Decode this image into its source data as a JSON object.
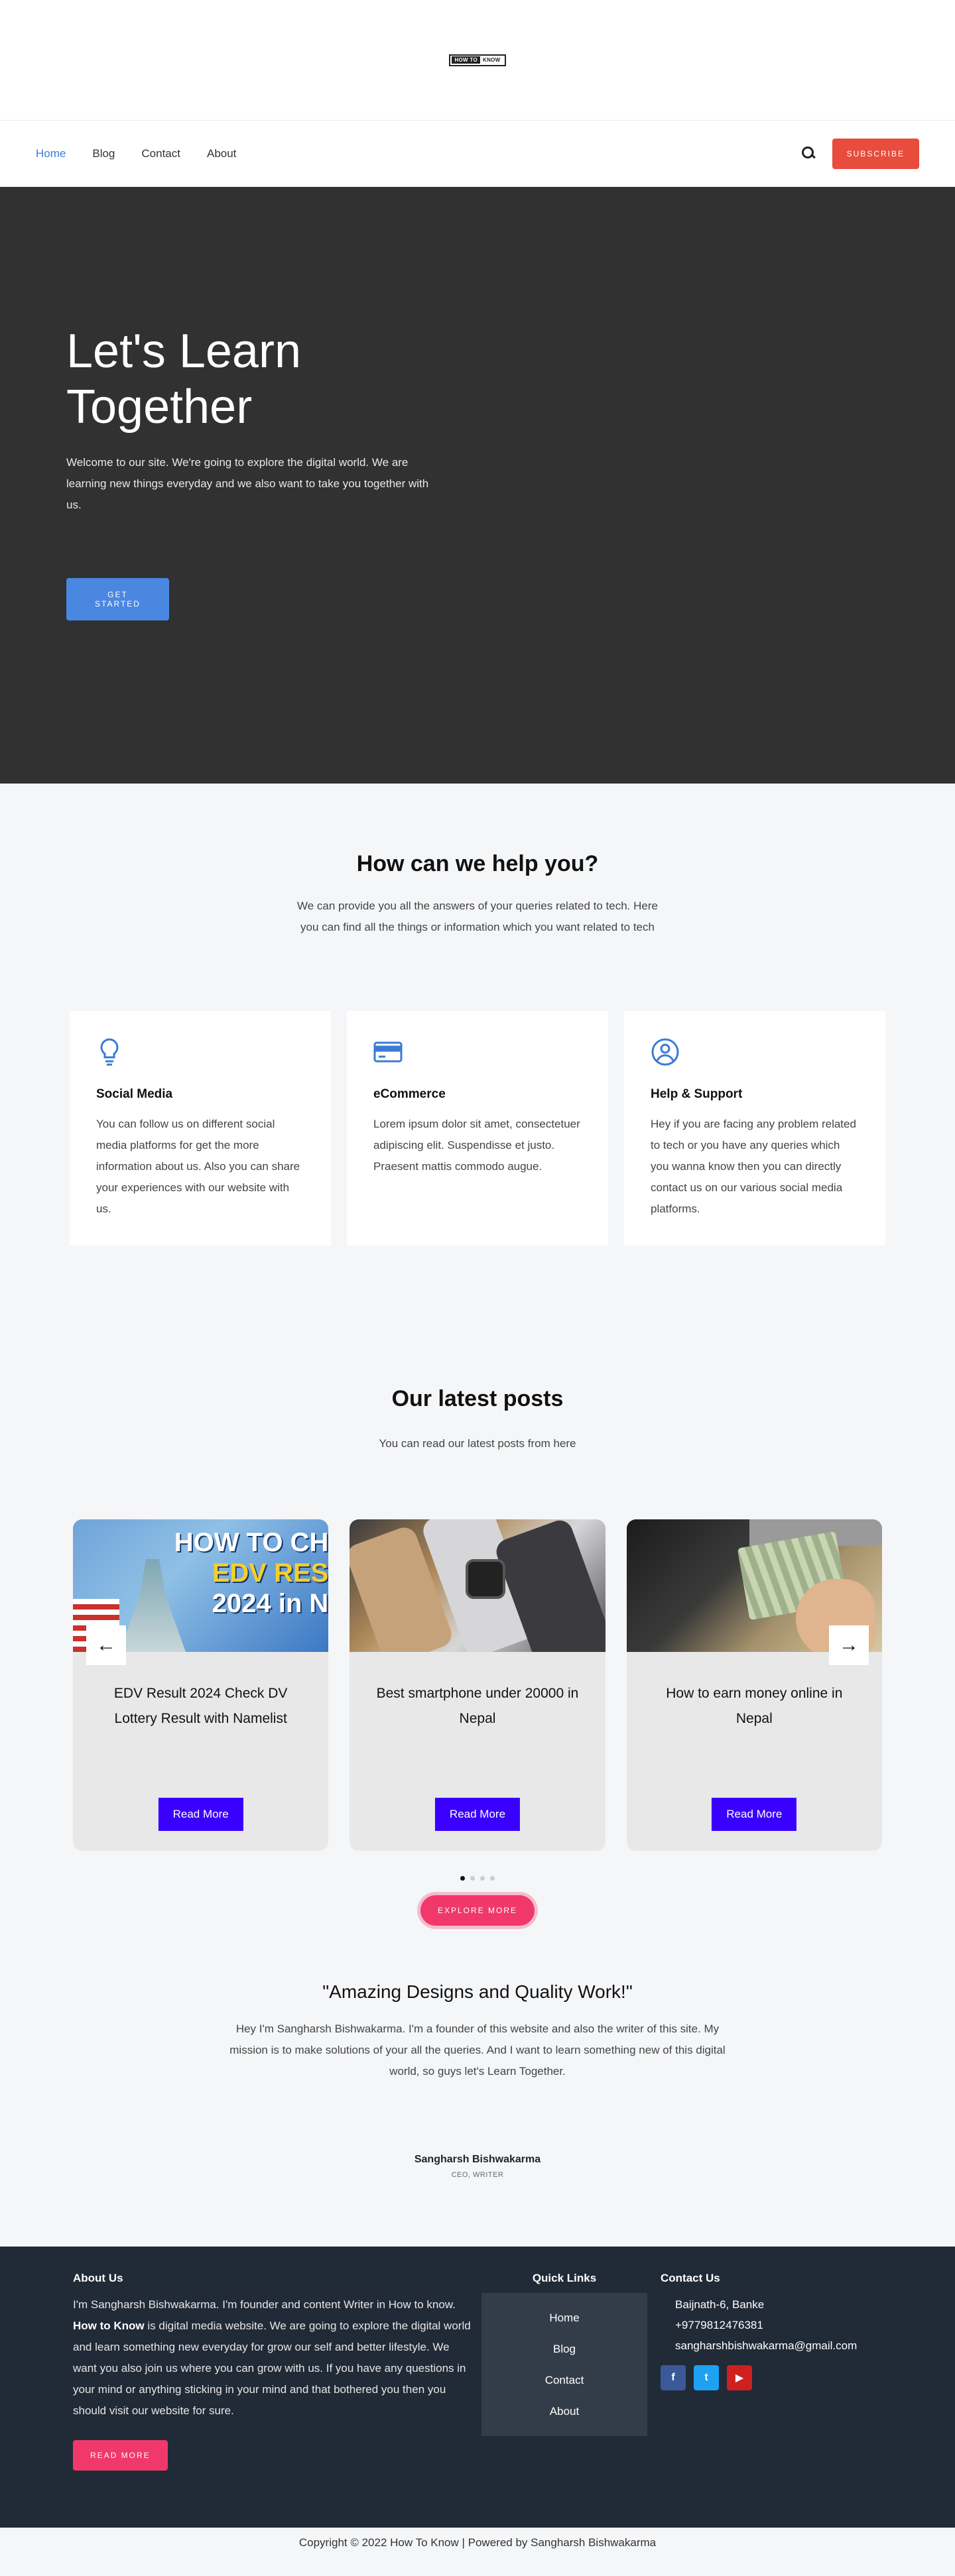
{
  "logo": {
    "left": "HOW TO",
    "right": "KNOW"
  },
  "nav": {
    "items": [
      "Home",
      "Blog",
      "Contact",
      "About"
    ],
    "subscribe": "SUBSCRIBE"
  },
  "hero": {
    "title": "Let's Learn Together",
    "text": "Welcome to our site. We're going to explore the digital world. We are learning new things everyday and we also want to take you together with us.",
    "button": "GET STARTED"
  },
  "help": {
    "title": "How can we help you?",
    "subtitle": "We can provide you all the answers of your queries related to tech. Here you can find all the things or information which you want related to tech",
    "cards": [
      {
        "icon": "lightbulb-icon",
        "title": "Social Media",
        "text": "You can follow us on different social media platforms for get the more information about us. Also you can share your experiences with our website with us."
      },
      {
        "icon": "credit-card-icon",
        "title": "eCommerce",
        "text": "Lorem ipsum dolor sit amet, consectetuer adipiscing elit. Suspendisse et justo. Praesent mattis commodo augue."
      },
      {
        "icon": "user-circle-icon",
        "title": "Help & Support",
        "text": "Hey if you are facing any problem related to tech or you have any queries which you wanna know then you can directly contact us on our various social media platforms."
      }
    ]
  },
  "posts": {
    "title": "Our latest posts",
    "subtitle": "You can read our latest posts from here",
    "items": [
      {
        "title": "EDV Result 2024 Check DV Lottery Result with Namelist",
        "button": "Read More",
        "image_text": {
          "l1": "HOW TO CH",
          "l2": "EDV RES",
          "l3": "2024 in N"
        }
      },
      {
        "title": "Best smartphone under 20000 in Nepal",
        "button": "Read More"
      },
      {
        "title": "How to earn money online in Nepal",
        "button": "Read More"
      }
    ],
    "explore": "EXPLORE MORE"
  },
  "testimonial": {
    "quote": "\"Amazing Designs and Quality Work!\"",
    "text": "Hey I'm Sangharsh Bishwakarma. I'm a founder of this website and also the writer of this site. My mission is to make solutions of your all the queries. And I want to learn something new of this digital world, so guys let's Learn Together.",
    "author": "Sangharsh Bishwakarma",
    "role": "CEO, WRITER"
  },
  "footer": {
    "about_title": "About Us",
    "about_pre": "I'm Sangharsh Bishwakarma. I'm founder and content Writer in How to know.",
    "about_bold": "How to Know",
    "about_post": "is digital media website. We are going to explore the digital world and learn something new everyday for grow our self and better lifestyle. We want you also join us where you can grow with us. If you have any questions in your mind or anything sticking in your mind and that bothered you then you should visit our website for sure.",
    "read_more": "READ MORE",
    "links_title": "Quick Links",
    "links": [
      "Home",
      "Blog",
      "Contact",
      "About"
    ],
    "contact_title": "Contact Us",
    "address": "Baijnath-6, Banke",
    "phone": "+9779812476381",
    "email": "sangharshbishwakarma@gmail.com",
    "socials": {
      "fb": "f",
      "tw": "t",
      "yt": "▶"
    },
    "copyright": "Copyright © 2022 How To Know | Powered by Sangharsh Bishwakarma"
  },
  "colors": {
    "accent": "#3a7bd5",
    "subscribe": "#e84c3d",
    "hero_bg": "#303130",
    "read_btn": "#3a00ff",
    "pink": "#f0386b",
    "footer_bg": "#212a37"
  }
}
